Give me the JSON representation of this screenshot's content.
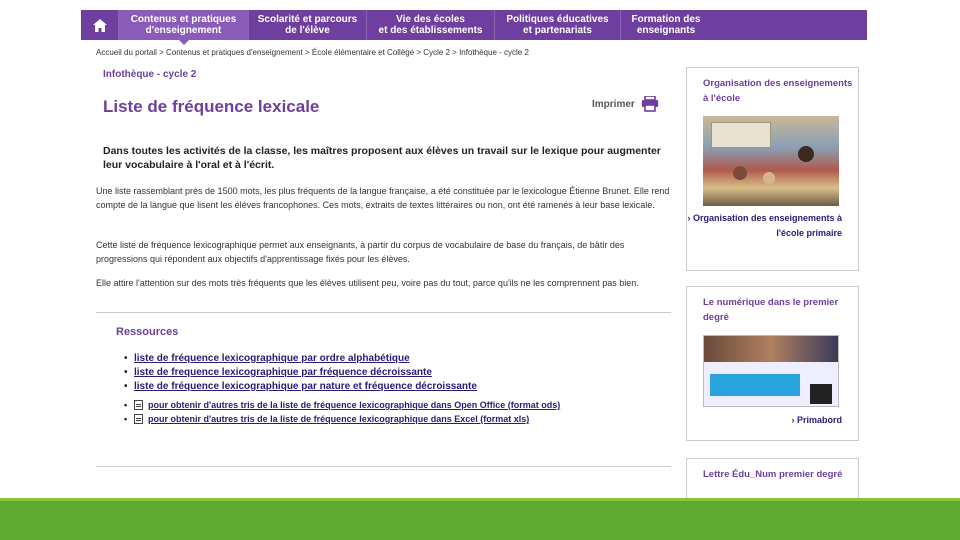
{
  "nav": {
    "home_icon": "home-icon",
    "items": [
      {
        "label": "Contenus et pratiques\nd'enseignement",
        "active": true
      },
      {
        "label": "Scolarité et parcours\nde l'élève",
        "active": false
      },
      {
        "label": "Vie des écoles\net des établissements",
        "active": false
      },
      {
        "label": "Politiques éducatives\net partenariats",
        "active": false
      },
      {
        "label": "Formation des\nenseignants",
        "active": false
      }
    ]
  },
  "breadcrumb": "Accueil du portail > Contenus et pratiques d'enseignement > École élémentaire et Collège > Cycle 2 > Infothèque - cycle 2",
  "section_tag": "Infothèque - cycle 2",
  "page_title": "Liste de fréquence lexicale",
  "print_label": "Imprimer",
  "intro": "Dans toutes les activités de la classe, les maîtres proposent aux élèves un travail sur le lexique pour augmenter leur vocabulaire à l'oral et à l'écrit.",
  "paragraphs": [
    "Une liste rassemblant près de 1500 mots, les plus fréquents de la langue française, a été constituée par le lexicologue Étienne Brunet. Elle rend compte de la langue que lisent les élèves francophones. Ces mots, extraits de textes littéraires ou non, ont été ramenés à leur base lexicale.",
    "Cette liste de fréquence lexicographique permet aux enseignants, à partir du corpus de vocabulaire de base du français, de bâtir des progressions qui répondent aux objectifs d'apprentissage fixés pour les élèves.",
    "Elle attire l'attention sur des mots très fréquents que les élèves utilisent peu, voire pas du tout, parce qu'ils ne les comprennent pas bien."
  ],
  "resources": {
    "title": "Ressources",
    "links": [
      "liste de fréquence lexicographique par ordre alphabétique",
      "liste de frequence lexicographique par fréquence décroissante",
      "liste de fréquence lexicographique par nature et fréquence décroissante"
    ],
    "files": [
      "pour obtenir d'autres tris de la liste de fréquence lexicographique dans Open Office (format ods)",
      "pour obtenir d'autres tris de la liste de fréquence lexicographique dans Excel (format xls)"
    ]
  },
  "sidebar": {
    "box1": {
      "title": "Organisation des enseignements à l'école",
      "link": "› Organisation des enseignements à l'école primaire"
    },
    "box2": {
      "title": "Le numérique dans le premier degré",
      "link": "› Primabord"
    },
    "box3": {
      "title": "Lettre Édu_Num premier degré"
    }
  },
  "colors": {
    "brand": "#6e3f9e",
    "footer_green": "#5fa932"
  }
}
